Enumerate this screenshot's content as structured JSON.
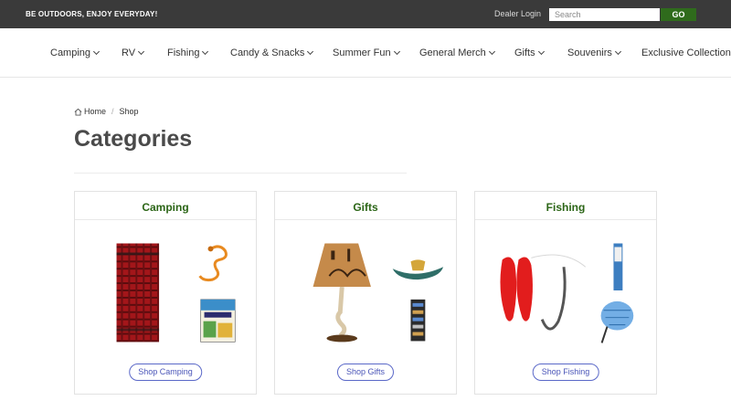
{
  "topbar": {
    "tagline": "BE OUTDOORS, ENJOY EVERYDAY!",
    "dealer_login": "Dealer Login",
    "search_placeholder": "Search",
    "go_label": "GO"
  },
  "nav": {
    "items": [
      {
        "label": "Camping"
      },
      {
        "label": "RV"
      },
      {
        "label": "Fishing"
      },
      {
        "label": "Candy & Snacks"
      },
      {
        "label": "Summer Fun"
      },
      {
        "label": "General Merch"
      },
      {
        "label": "Gifts"
      },
      {
        "label": "Souvenirs"
      },
      {
        "label": "Exclusive Collections"
      }
    ]
  },
  "breadcrumb": {
    "home": "Home",
    "current": "Shop"
  },
  "page_title": "Categories",
  "cards": [
    {
      "title": "Camping",
      "button": "Shop Camping"
    },
    {
      "title": "Gifts",
      "button": "Shop Gifts"
    },
    {
      "title": "Fishing",
      "button": "Shop Fishing"
    }
  ],
  "colors": {
    "topbar": "#3a3a3a",
    "go_button": "#2f6b1c",
    "card_title": "#2b6516",
    "shop_button": "#4a55b8"
  }
}
